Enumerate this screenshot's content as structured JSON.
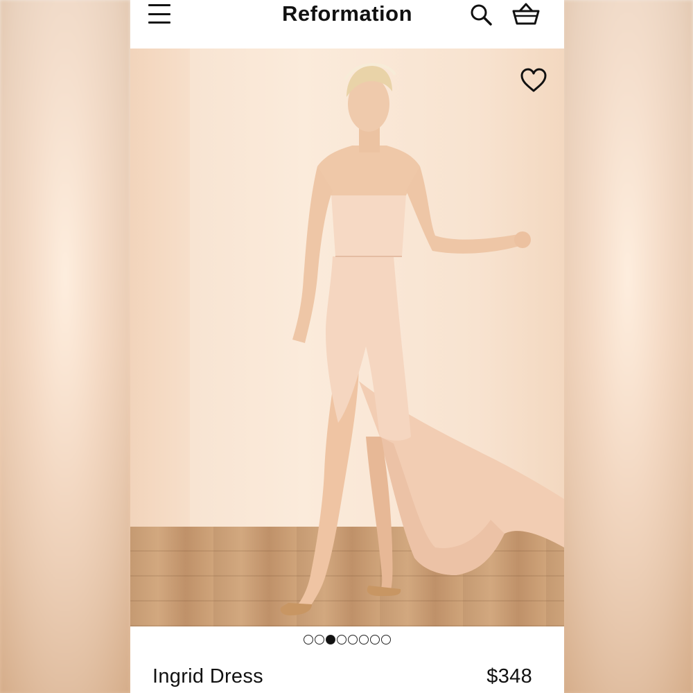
{
  "header": {
    "brand": "Reformation",
    "menu_icon": "hamburger-menu-icon",
    "search_icon": "search-icon",
    "bag_icon": "shopping-basket-icon"
  },
  "product": {
    "name": "Ingrid Dress",
    "price": "$348",
    "favorite_icon": "heart-icon",
    "image_count": 8,
    "active_image_index": 2
  },
  "colors": {
    "text": "#111111",
    "background": "#ffffff",
    "dress": "#f3d3bd"
  }
}
